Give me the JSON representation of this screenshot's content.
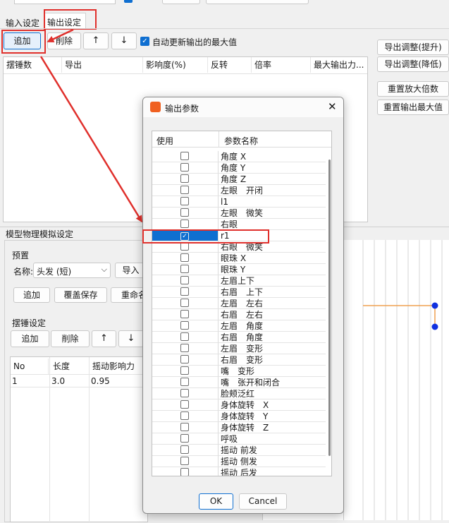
{
  "tabs": [
    {
      "label": "输入设定"
    },
    {
      "label": "输出设定"
    }
  ],
  "output_toolbar": {
    "add": "追加",
    "delete": "削除",
    "up": "↑",
    "down": "↓",
    "auto_update_label": "自动更新输出的最大值",
    "auto_update_checked": true
  },
  "output_table": {
    "headers": [
      "摆锤数",
      "导出",
      "影响度(%)",
      "反转",
      "倍率",
      "最大输出力..."
    ]
  },
  "side_buttons": [
    "导出调整(提升)",
    "导出调整(降低)",
    "重置放大倍数",
    "重置输出最大值"
  ],
  "physics": {
    "title": "模型物理模拟设定",
    "preset_label": "预置",
    "name_label": "名称:",
    "name_value": "头发 (短)",
    "import_label": "导入",
    "add_label": "追加",
    "overwrite_label": "覆盖保存",
    "rename_label": "重命名",
    "pendulum_label": "摆锤设定",
    "p_add": "追加",
    "p_delete": "削除",
    "p_up": "↑",
    "p_down": "↓",
    "table_headers": [
      "No",
      "长度",
      "摇动影响力"
    ],
    "table_rows": [
      [
        "1",
        "3.0",
        "0.95"
      ]
    ]
  },
  "dialog": {
    "title": "输出参数",
    "col_use": "使用",
    "col_name": "参数名称",
    "ok": "OK",
    "cancel": "Cancel",
    "params": [
      {
        "name": "角度 X",
        "checked": false
      },
      {
        "name": "角度 Y",
        "checked": false
      },
      {
        "name": "角度 Z",
        "checked": false
      },
      {
        "name": "左眼　开闭",
        "checked": false
      },
      {
        "name": "l1",
        "checked": false
      },
      {
        "name": "左眼　微笑",
        "checked": false
      },
      {
        "name": "右眼",
        "checked": false
      },
      {
        "name": "r1",
        "checked": true,
        "selected": true
      },
      {
        "name": "右眼　微笑",
        "checked": false
      },
      {
        "name": "眼珠 X",
        "checked": false
      },
      {
        "name": "眼珠 Y",
        "checked": false
      },
      {
        "name": "左眉上下",
        "checked": false
      },
      {
        "name": "右眉　上下",
        "checked": false
      },
      {
        "name": "左眉　左右",
        "checked": false
      },
      {
        "name": "右眉　左右",
        "checked": false
      },
      {
        "name": "左眉　角度",
        "checked": false
      },
      {
        "name": "右眉　角度",
        "checked": false
      },
      {
        "name": "左眉　变形",
        "checked": false
      },
      {
        "name": "右眉　变形",
        "checked": false
      },
      {
        "name": "嘴　变形",
        "checked": false
      },
      {
        "name": "嘴　张开和闭合",
        "checked": false
      },
      {
        "name": "脸颊泛红",
        "checked": false
      },
      {
        "name": "身体旋转　X",
        "checked": false
      },
      {
        "name": "身体旋转　Y",
        "checked": false
      },
      {
        "name": "身体旋转　Z",
        "checked": false
      },
      {
        "name": "呼吸",
        "checked": false
      },
      {
        "name": "摇动 前发",
        "checked": false
      },
      {
        "name": "摇动 侧发",
        "checked": false
      },
      {
        "name": "摇动 后发",
        "checked": false
      }
    ]
  },
  "colors": {
    "accent": "#0f6fd1",
    "annotation": "#e0302c",
    "dot": "#1030e0",
    "line": "#f0a050"
  }
}
